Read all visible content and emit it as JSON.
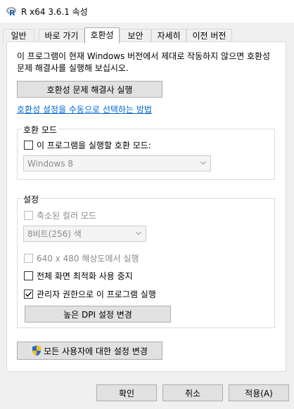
{
  "window": {
    "title": "R x64 3.6.1 속성"
  },
  "tabs": [
    {
      "label": "일반",
      "active": false
    },
    {
      "label": "바로 가기",
      "active": false
    },
    {
      "label": "호환성",
      "active": true
    },
    {
      "label": "보안",
      "active": false
    },
    {
      "label": "자세히",
      "active": false
    },
    {
      "label": "이전 버전",
      "active": false
    }
  ],
  "compat": {
    "description": "이 프로그램이 현재 Windows 버전에서 제대로 작동하지 않으면 호환성 문제 해결사를 실행해 보십시오.",
    "run_troubleshooter_button": "호환성 문제 해결사 실행",
    "manual_link": "호환성 설정을 수동으로 선택하는 방법"
  },
  "compat_mode": {
    "group_label": "호환 모드",
    "checkbox_label": "이 프로그램을 실행할 호환 모드:",
    "checked": false,
    "selected_os": "Windows 8"
  },
  "settings": {
    "group_label": "설정",
    "reduced_color": {
      "label": "축소된 컬러 모드",
      "checked": false,
      "disabled": true
    },
    "color_select": "8비트(256) 색",
    "res_640": {
      "label": "640 x 480 해상도에서 실행",
      "checked": false,
      "disabled": true
    },
    "disable_fullscreen": {
      "label": "전체 화면 최적화 사용 중지",
      "checked": false
    },
    "run_as_admin": {
      "label": "관리자 권한으로 이 프로그램 실행",
      "checked": true
    },
    "high_dpi_button": "높은 DPI 설정 변경"
  },
  "all_users_button": "모든 사용자에 대한 설정 변경",
  "footer": {
    "ok": "확인",
    "cancel": "취소",
    "apply": "적용(A)"
  },
  "colors": {
    "link": "#0066cc",
    "window_bg": "#f0f0f0",
    "panel_bg": "#ffffff"
  }
}
